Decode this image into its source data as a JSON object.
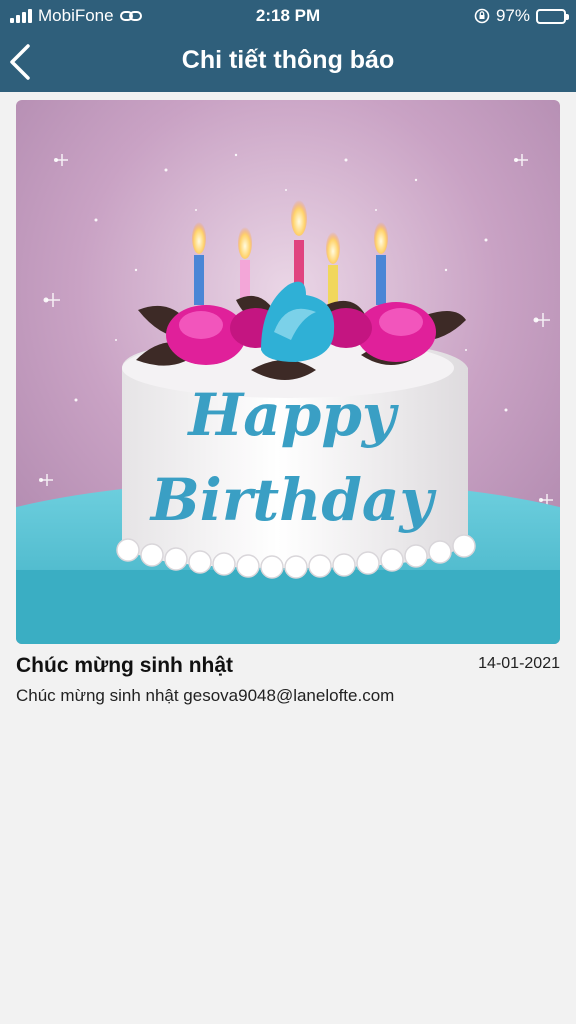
{
  "status_bar": {
    "carrier": "MobiFone",
    "time": "2:18 PM",
    "battery": "97%",
    "battery_level": 0.97
  },
  "header": {
    "title": "Chi tiết thông báo",
    "back_icon": "chevron-left-icon"
  },
  "banner": {
    "cake_text_line1": "Happy",
    "cake_text_line2": "Birthday"
  },
  "notification": {
    "title": "Chúc mừng sinh nhật",
    "date": "14-01-2021",
    "body": "Chúc mừng sinh nhật gesova9048@lanelofte.com"
  },
  "colors": {
    "header_bg": "#2f5f7b",
    "page_bg": "#f2f2f2",
    "cake_text": "#3a9fc4"
  }
}
